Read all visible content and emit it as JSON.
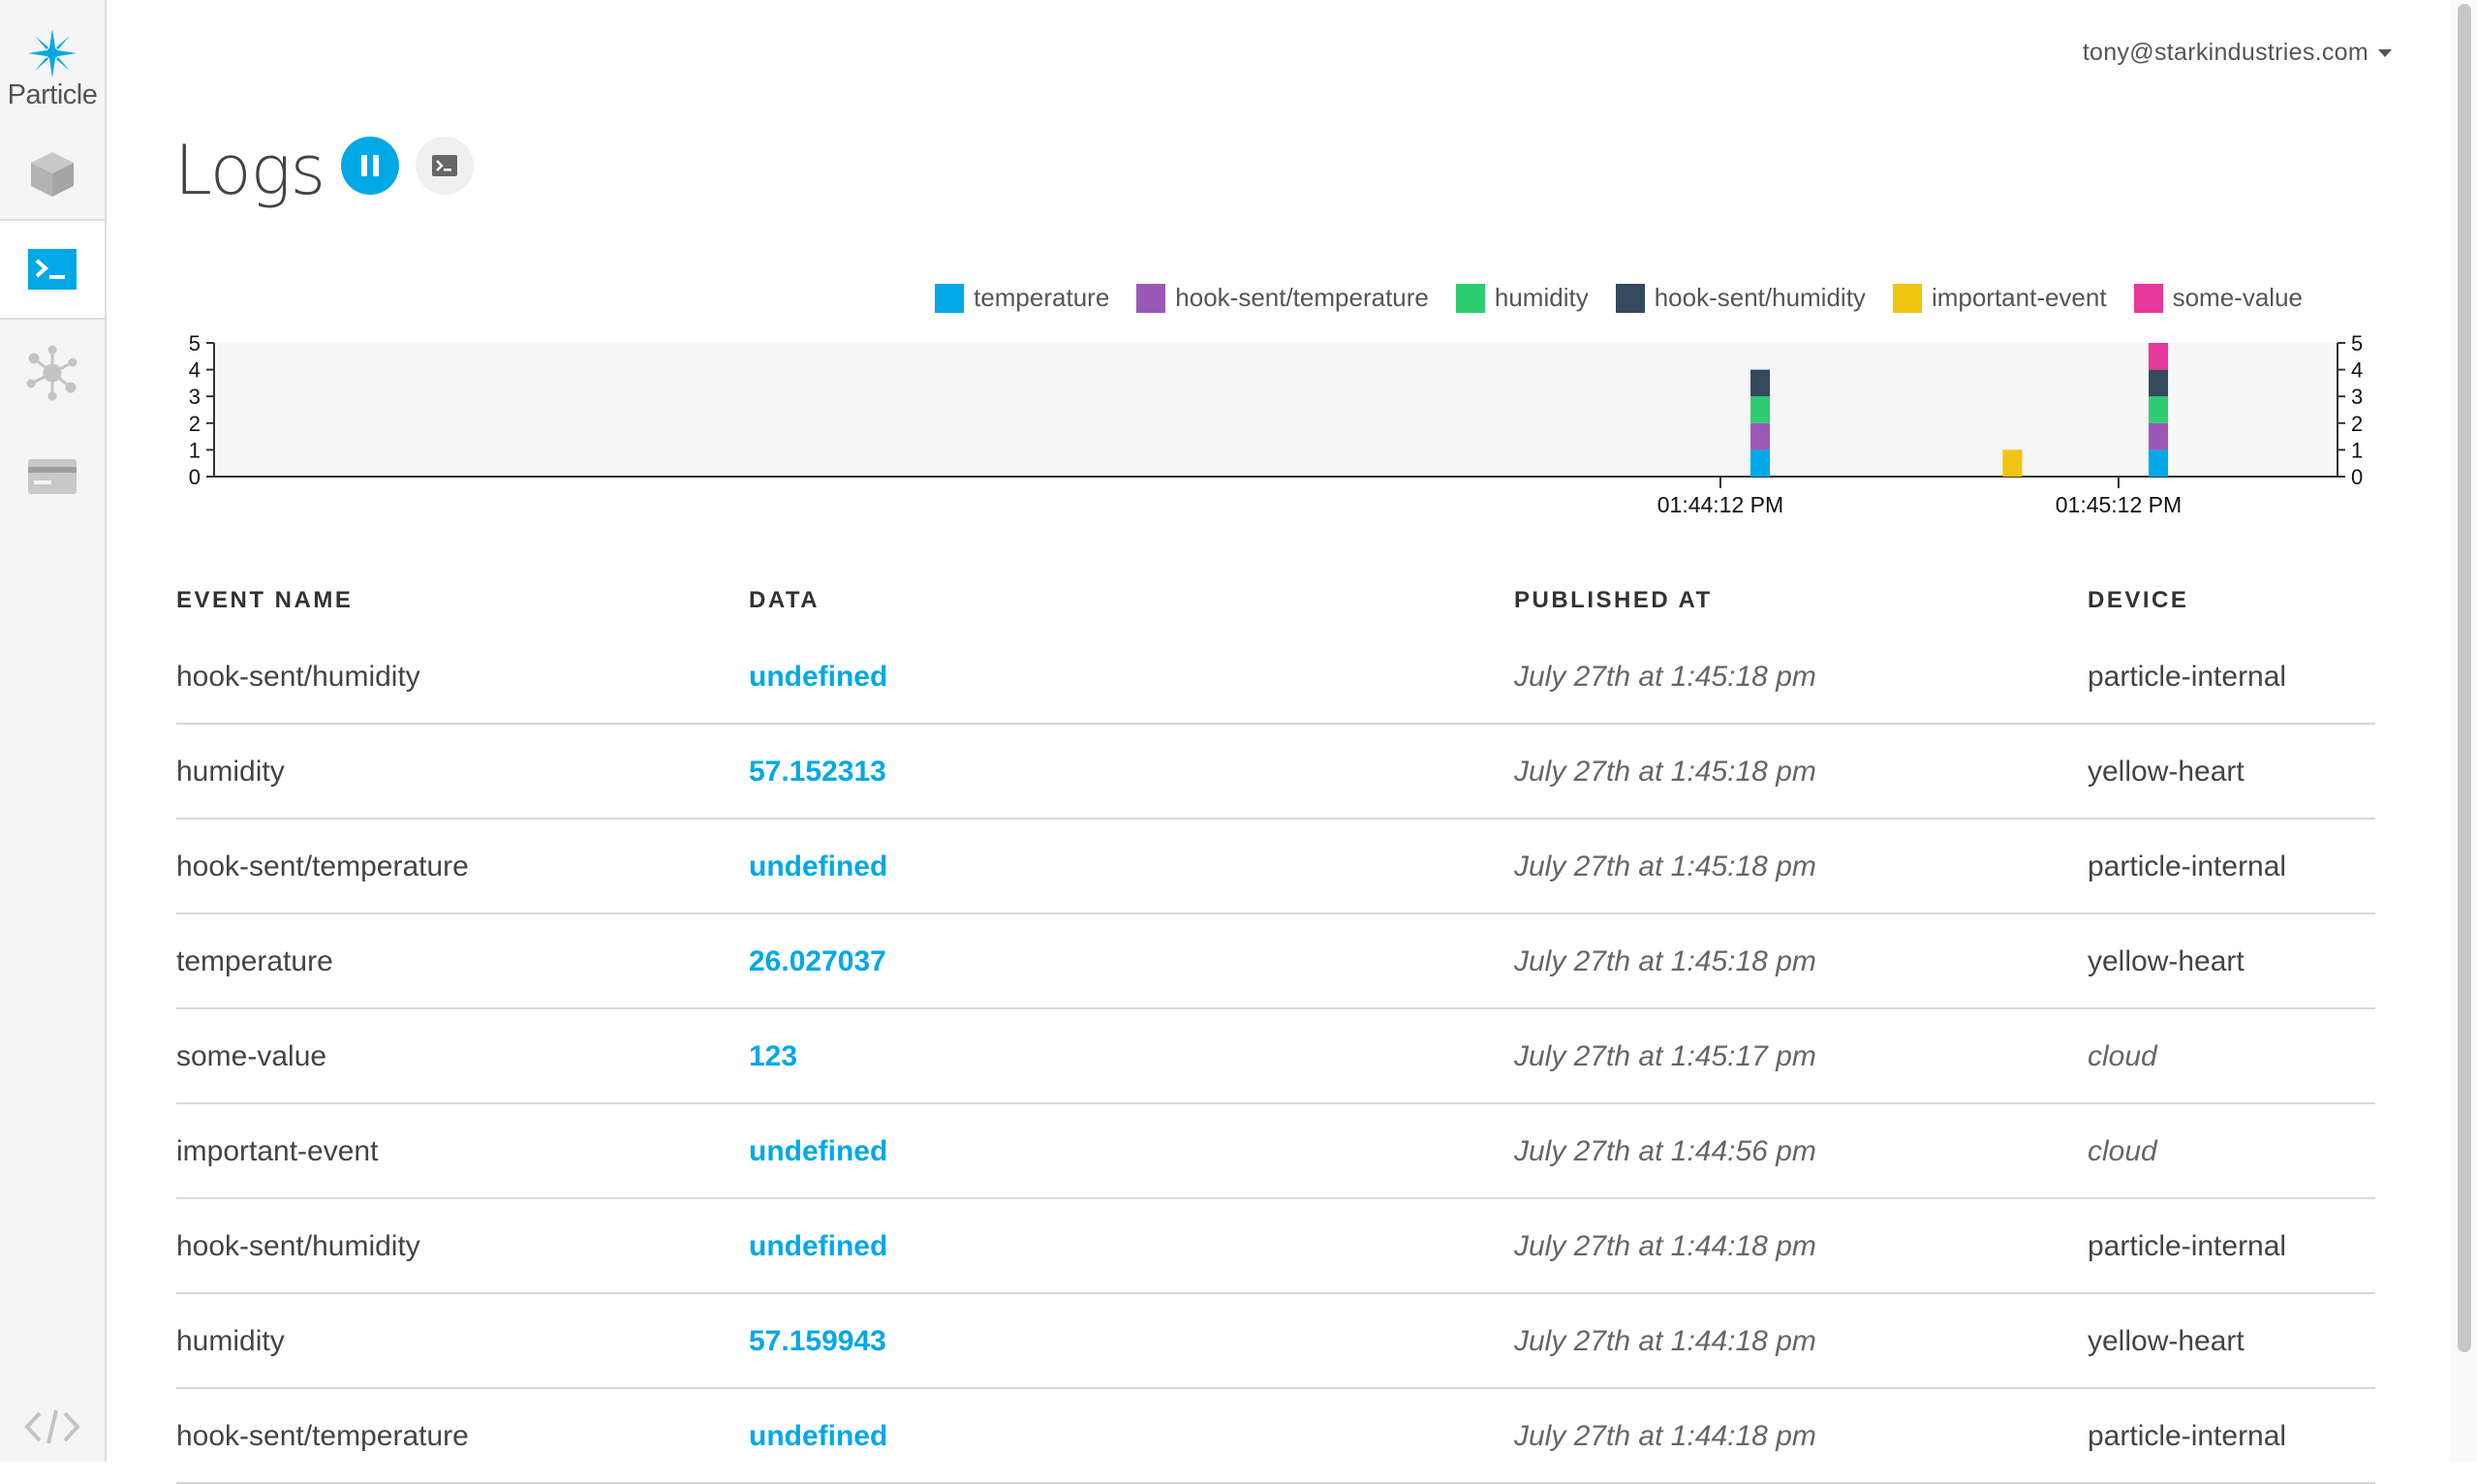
{
  "brand": {
    "name": "Particle"
  },
  "user": {
    "email": "tony@starkindustries.com"
  },
  "page": {
    "title": "Logs"
  },
  "colors": {
    "accent": "#00a8e6",
    "temperature": "#00a8e6",
    "hook_sent_temperature": "#9b59b6",
    "humidity": "#2ecc71",
    "hook_sent_humidity": "#34495e",
    "important_event": "#f1c40f",
    "some_value": "#e6399b"
  },
  "legend": [
    {
      "label": "temperature",
      "color": "#00a8e6"
    },
    {
      "label": "hook-sent/temperature",
      "color": "#9b59b6"
    },
    {
      "label": "humidity",
      "color": "#2ecc71"
    },
    {
      "label": "hook-sent/humidity",
      "color": "#34495e"
    },
    {
      "label": "important-event",
      "color": "#f1c40f"
    },
    {
      "label": "some-value",
      "color": "#e6399b"
    }
  ],
  "chart_data": {
    "type": "bar",
    "stacked": true,
    "ylim": [
      0,
      5
    ],
    "yticks": [
      0,
      1,
      2,
      3,
      4,
      5
    ],
    "xlim": [
      "01:40:25 PM",
      "01:45:45 PM"
    ],
    "xticks": [
      "01:44:12 PM",
      "01:45:12 PM"
    ],
    "grid": false,
    "legend_position": "top-right",
    "bars": [
      {
        "time": "01:44:18 PM",
        "stack": [
          {
            "series": "temperature",
            "value": 1
          },
          {
            "series": "hook-sent/temperature",
            "value": 1
          },
          {
            "series": "humidity",
            "value": 1
          },
          {
            "series": "hook-sent/humidity",
            "value": 1
          }
        ]
      },
      {
        "time": "01:44:56 PM",
        "stack": [
          {
            "series": "important-event",
            "value": 1
          }
        ]
      },
      {
        "time": "01:45:18 PM",
        "stack": [
          {
            "series": "temperature",
            "value": 1
          },
          {
            "series": "hook-sent/temperature",
            "value": 1
          },
          {
            "series": "humidity",
            "value": 1
          },
          {
            "series": "hook-sent/humidity",
            "value": 1
          },
          {
            "series": "some-value",
            "value": 1
          }
        ]
      }
    ]
  },
  "table": {
    "headers": {
      "name": "EVENT NAME",
      "data": "DATA",
      "published": "PUBLISHED AT",
      "device": "DEVICE"
    },
    "rows": [
      {
        "name": "hook-sent/humidity",
        "data": "undefined",
        "published": "July 27th at 1:45:18 pm",
        "device": "particle-internal"
      },
      {
        "name": "humidity",
        "data": "57.152313",
        "published": "July 27th at 1:45:18 pm",
        "device": "yellow-heart"
      },
      {
        "name": "hook-sent/temperature",
        "data": "undefined",
        "published": "July 27th at 1:45:18 pm",
        "device": "particle-internal"
      },
      {
        "name": "temperature",
        "data": "26.027037",
        "published": "July 27th at 1:45:18 pm",
        "device": "yellow-heart"
      },
      {
        "name": "some-value",
        "data": "123",
        "published": "July 27th at 1:45:17 pm",
        "device": "cloud"
      },
      {
        "name": "important-event",
        "data": "undefined",
        "published": "July 27th at 1:44:56 pm",
        "device": "cloud"
      },
      {
        "name": "hook-sent/humidity",
        "data": "undefined",
        "published": "July 27th at 1:44:18 pm",
        "device": "particle-internal"
      },
      {
        "name": "humidity",
        "data": "57.159943",
        "published": "July 27th at 1:44:18 pm",
        "device": "yellow-heart"
      },
      {
        "name": "hook-sent/temperature",
        "data": "undefined",
        "published": "July 27th at 1:44:18 pm",
        "device": "particle-internal"
      }
    ]
  },
  "icons": {
    "logo": "particle-star-icon",
    "devices": "cube-icon",
    "logs": "terminal-icon",
    "integrations": "network-icon",
    "billing": "credit-card-icon",
    "ide": "code-icon"
  }
}
